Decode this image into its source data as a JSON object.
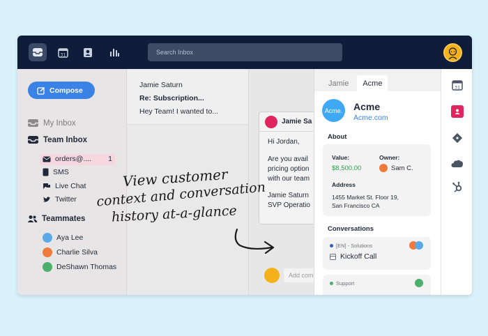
{
  "search": {
    "placeholder": "Search Inbox"
  },
  "sidebar": {
    "compose_label": "Compose",
    "my_inbox": "My Inbox",
    "team_inbox": "Team Inbox",
    "channels": [
      {
        "label": "orders@....",
        "count": "1",
        "icon": "envelope-icon"
      },
      {
        "label": "SMS",
        "icon": "sms-icon"
      },
      {
        "label": "Live Chat",
        "icon": "chat-icon"
      },
      {
        "label": "Twitter",
        "icon": "twitter-icon"
      }
    ],
    "teammates_header": "Teammates",
    "teammates": [
      {
        "name": "Aya Lee",
        "color": "#5aa9e6"
      },
      {
        "name": "Charlie Silva",
        "color": "#f07a3a"
      },
      {
        "name": "DeShawn Thomas",
        "color": "#4caf6d"
      }
    ]
  },
  "message_list": {
    "item": {
      "sender": "Jamie Saturn",
      "subject": "Re: Subscription...",
      "preview": "Hey Team! I wanted to..."
    }
  },
  "conversation": {
    "sender": "Jamie Sa",
    "greeting": "Hi Jordan,",
    "body_lines": [
      "Are you avail",
      "pricing option",
      "with our team"
    ],
    "signature_lines": [
      "Jamie Saturn",
      "SVP Operatio"
    ],
    "comment_placeholder": "Add com"
  },
  "panel": {
    "tabs": [
      "Jamie",
      "Acme"
    ],
    "logo_text": "Acme.",
    "company": "Acme",
    "website": "Acme.com",
    "about_header": "About",
    "value_label": "Value:",
    "value": "$8,500.00",
    "owner_label": "Owner:",
    "owner": "Sam C.",
    "address_label": "Address",
    "address_lines": [
      "1455 Market St. Floor 19,",
      "San Francisco CA"
    ],
    "conversations_header": "Conversations",
    "conversations": [
      {
        "tag": "[EN] - Solutions",
        "title": "Kickoff Call",
        "dot_color": "#2f5fb3"
      },
      {
        "tag": "Support",
        "title": "",
        "dot_color": "#4caf6d"
      }
    ]
  },
  "annotation": {
    "lines": [
      "View customer",
      "context and conversation",
      "history at-a-glance"
    ]
  },
  "colors": {
    "accent": "#3a82e6",
    "topbar": "#0f1d3a",
    "value_green": "#2e9e4f"
  }
}
